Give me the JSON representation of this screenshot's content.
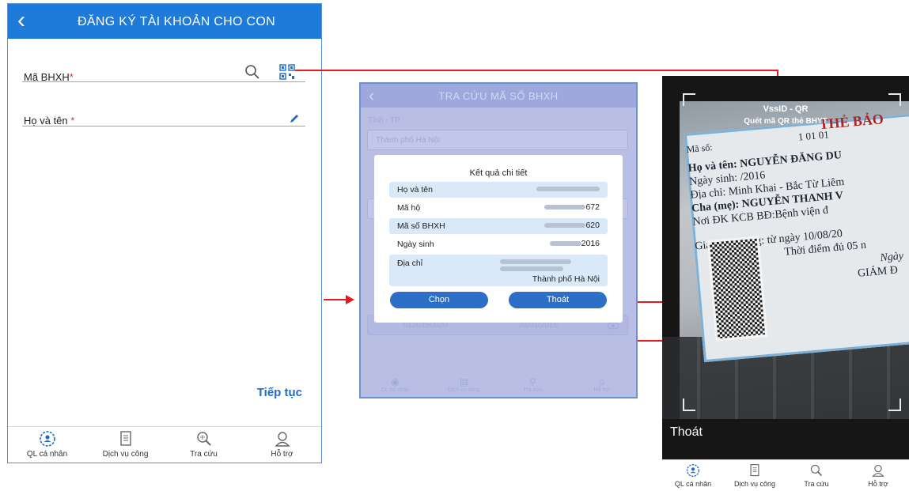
{
  "screen1": {
    "title": "ĐĂNG KÝ TÀI KHOẢN CHO CON",
    "bhxh_label": "Mã BHXH",
    "name_label": "Họ và tên",
    "required_mark": "*",
    "next_label": "Tiếp tục",
    "tabs": [
      "QL cá nhân",
      "Dịch vụ công",
      "Tra cứu",
      "Hỗ trợ"
    ]
  },
  "screen2": {
    "title": "TRA CỨU MÃ SỐ BHXH",
    "province_label": "Tỉnh - TP",
    "province_value": "Thành phố Hà Nội",
    "bg_row_values": [
      "0120150620",
      "20/01/2016"
    ],
    "modal": {
      "title": "Kết quả chi tiết",
      "rows": [
        {
          "label": "Họ và tên",
          "value": ""
        },
        {
          "label": "Mã hộ",
          "value": "672"
        },
        {
          "label": "Mã số BHXH",
          "value": "620"
        },
        {
          "label": "Ngày sinh",
          "value": "2016"
        },
        {
          "label": "Địa chỉ",
          "value": "Thành phố Hà Nội"
        }
      ],
      "select_label": "Chọn",
      "exit_label": "Thoát"
    },
    "tabs": [
      "QL cá nhân",
      "Dịch vụ công",
      "Tra cứu",
      "Hỗ trợ"
    ]
  },
  "screen3": {
    "app_title": "VssID - QR",
    "subtitle": "Quét mã QR thẻ BHYT",
    "card_lines": {
      "header": "THẺ BẢO",
      "code_label": "Mã số:",
      "code_digits": "1   01   01",
      "name": "Họ và tên:  NGUYỄN ĐĂNG DU",
      "dob": "Ngày sinh:          /2016",
      "address": "Địa chỉ:  Minh Khai - Bắc Từ Liêm",
      "parent": "Cha (mẹ):  NGUYỄN THANH V",
      "clinic": "Nơi ĐK KCB BĐ:Bệnh viện đ",
      "validity": "Giá trị sử dụng: từ ngày  10/08/20",
      "time": "Thời điểm đủ 05 n",
      "sign1": "Ngày",
      "sign2": "GIÁM Đ"
    },
    "exit_label": "Thoát",
    "tabs": [
      "QL cá nhân",
      "Dịch vụ công",
      "Tra cứu",
      "Hỗ trợ"
    ]
  },
  "colors": {
    "primary": "#1e7bd9",
    "arrow": "#e11b1b",
    "button": "#2d6fc7"
  }
}
